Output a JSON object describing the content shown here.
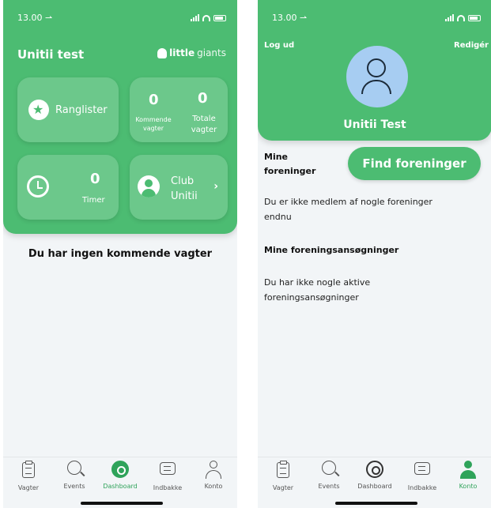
{
  "status_bar": {
    "time": "13.00 ⇀"
  },
  "colors": {
    "brand_green": "#4cbc72",
    "active_tab": "#2fa35a",
    "avatar_bg": "#a7cdf2"
  },
  "dashboard": {
    "team_title": "Unitii test",
    "brand_bold": "little",
    "brand_light": "giants",
    "tiles": {
      "rank_label": "Ranglister",
      "upcoming_value": "0",
      "upcoming_label_1": "Kommende",
      "upcoming_label_2": "vagter",
      "total_value": "0",
      "total_label_1": "Totale",
      "total_label_2": "vagter",
      "timer_value": "0",
      "timer_label": "Timer",
      "club_label_1": "Club",
      "club_label_2": "Unitii",
      "club_chevron": "›"
    },
    "empty_message": "Du har ingen kommende vagter"
  },
  "profile": {
    "logout": "Log ud",
    "edit": "Redigér",
    "name": "Unitii Test",
    "my_assoc_1": "Mine",
    "my_assoc_2": "foreninger",
    "find_button": "Find foreninger",
    "no_member_1": "Du er ikke medlem af nogle foreninger",
    "no_member_2": "endnu",
    "applications_title": "Mine foreningsansøgninger",
    "no_apps_1": "Du har ikke nogle aktive",
    "no_apps_2": "foreningsansøgninger"
  },
  "tabs": {
    "vagter": "Vagter",
    "events": "Events",
    "dashboard": "Dashboard",
    "indbakke": "Indbakke",
    "konto": "Konto"
  }
}
